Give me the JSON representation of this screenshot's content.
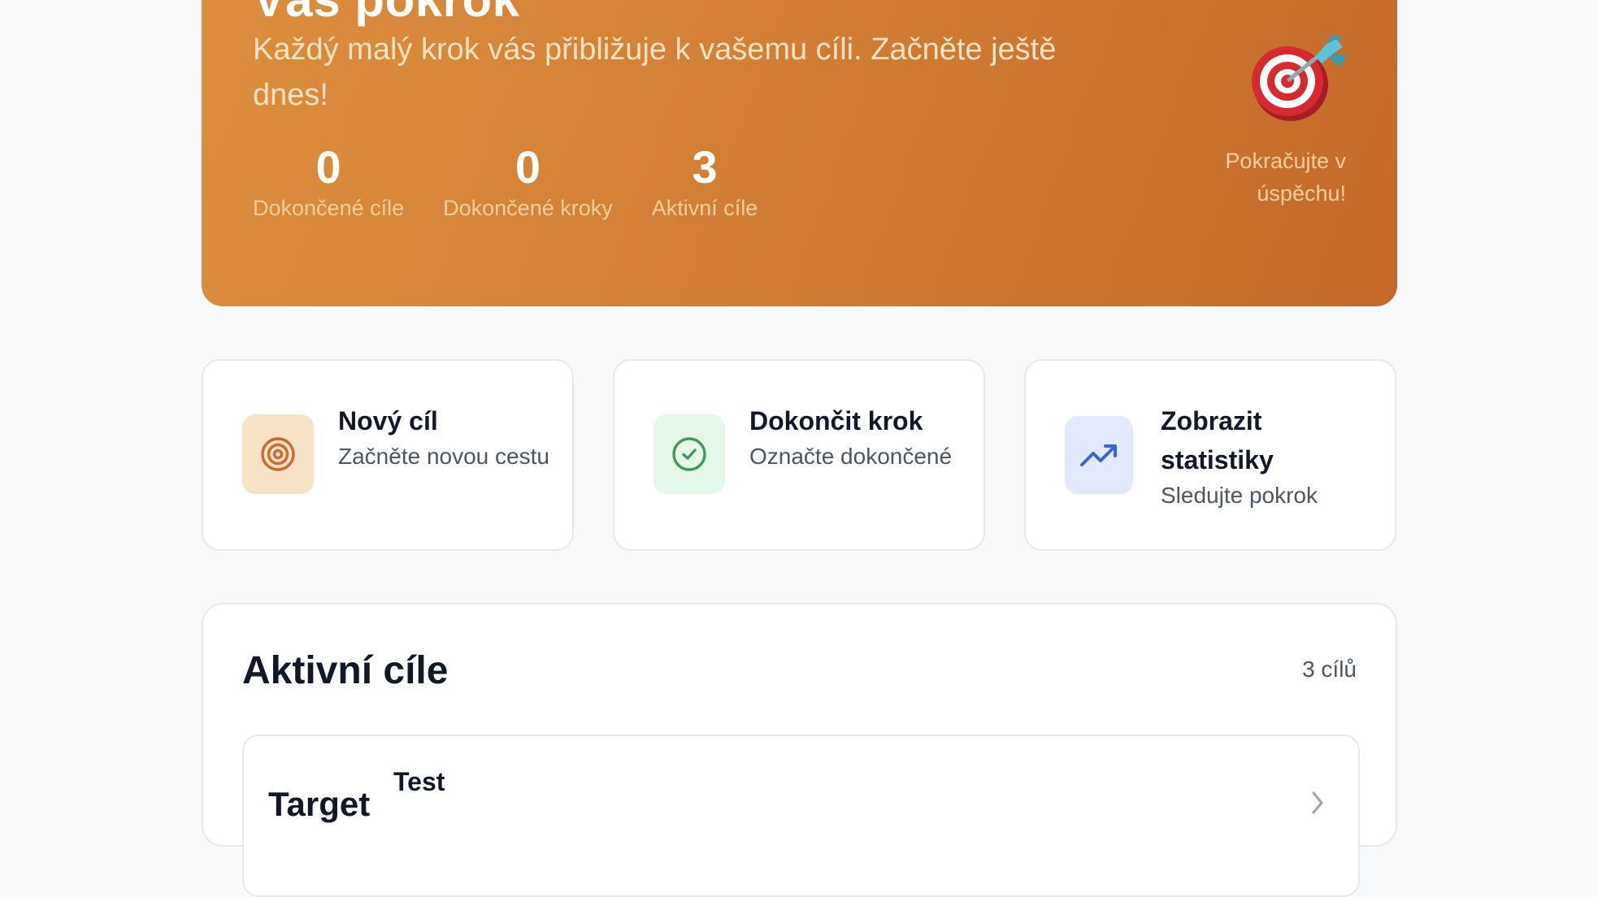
{
  "hero": {
    "title": "Váš pokrok",
    "subtitle": "Každý malý krok vás přibližuje k vašemu cíli. Začněte ještě dnes!",
    "stats": [
      {
        "value": "0",
        "label": "Dokončené cíle"
      },
      {
        "value": "0",
        "label": "Dokončené kroky"
      },
      {
        "value": "3",
        "label": "Aktivní cíle"
      }
    ],
    "side_icon": "target-dart-emoji",
    "side_text": "Pokračujte v úspěchu!"
  },
  "actions": [
    {
      "title": "Nový cíl",
      "subtitle": "Začněte novou cestu",
      "icon": "target-icon",
      "icon_bg": "#f9e3c6",
      "icon_color": "#c96a2a"
    },
    {
      "title": "Dokončit krok",
      "subtitle": "Označte dokončené",
      "icon": "check-circle-icon",
      "icon_bg": "#e3f8e8",
      "icon_color": "#3f9a57"
    },
    {
      "title": "Zobrazit statistiky",
      "subtitle": "Sledujte pokrok",
      "icon": "trending-up-icon",
      "icon_bg": "#e1e9fb",
      "icon_color": "#3a63d8"
    }
  ],
  "goals": {
    "title": "Aktivní cíle",
    "count": "3 cílů",
    "items": [
      {
        "icon_label": "Target",
        "name": "Test"
      }
    ]
  }
}
